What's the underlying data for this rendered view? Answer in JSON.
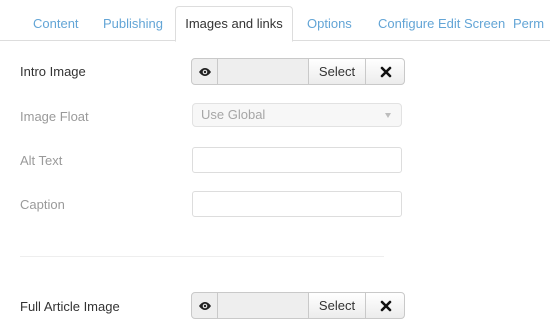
{
  "tabs": [
    {
      "label": "Content",
      "active": false
    },
    {
      "label": "Publishing",
      "active": false
    },
    {
      "label": "Images and links",
      "active": true
    },
    {
      "label": "Options",
      "active": false
    },
    {
      "label": "Configure Edit Screen",
      "active": false
    },
    {
      "label": "Perm",
      "active": false
    }
  ],
  "fields": {
    "intro_image": {
      "label": "Intro Image",
      "value": "",
      "select_label": "Select",
      "preview_icon": "eye-icon",
      "clear_icon": "close-icon"
    },
    "image_float": {
      "label": "Image Float",
      "selected": "Use Global",
      "caret_icon": "caret-down-icon"
    },
    "alt_text": {
      "label": "Alt Text",
      "value": ""
    },
    "caption": {
      "label": "Caption",
      "value": ""
    },
    "full_article_image": {
      "label": "Full Article Image",
      "value": "",
      "select_label": "Select",
      "preview_icon": "eye-icon",
      "clear_icon": "close-icon"
    }
  },
  "colors": {
    "tab_link": "#63a5d6",
    "text": "#333333",
    "muted_label": "#9a9a9a",
    "border": "#dddddd"
  }
}
